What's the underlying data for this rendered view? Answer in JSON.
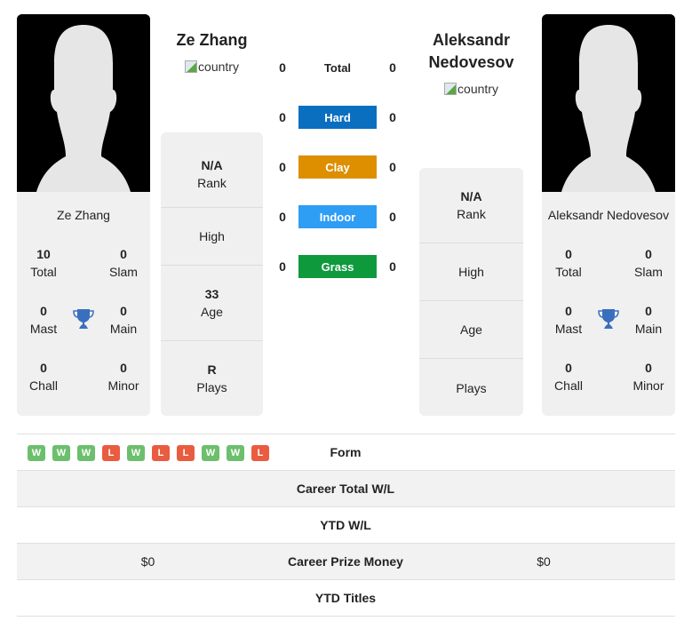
{
  "player1": {
    "name": "Ze Zhang",
    "country_alt": "country",
    "card_name": "Ze Zhang",
    "titles": {
      "total": {
        "value": "10",
        "label": "Total"
      },
      "slam": {
        "value": "0",
        "label": "Slam"
      },
      "mast": {
        "value": "0",
        "label": "Mast"
      },
      "main": {
        "value": "0",
        "label": "Main"
      },
      "chall": {
        "value": "0",
        "label": "Chall"
      },
      "minor": {
        "value": "0",
        "label": "Minor"
      }
    },
    "info": {
      "rank": {
        "value": "N/A",
        "label": "Rank"
      },
      "high": {
        "value": "",
        "label": "High"
      },
      "age": {
        "value": "33",
        "label": "Age"
      },
      "plays": {
        "value": "R",
        "label": "Plays"
      }
    }
  },
  "player2": {
    "name_line1": "Aleksandr",
    "name_line2": "Nedovesov",
    "country_alt": "country",
    "card_name": "Aleksandr Nedovesov",
    "titles": {
      "total": {
        "value": "0",
        "label": "Total"
      },
      "slam": {
        "value": "0",
        "label": "Slam"
      },
      "mast": {
        "value": "0",
        "label": "Mast"
      },
      "main": {
        "value": "0",
        "label": "Main"
      },
      "chall": {
        "value": "0",
        "label": "Chall"
      },
      "minor": {
        "value": "0",
        "label": "Minor"
      }
    },
    "info": {
      "rank": {
        "value": "N/A",
        "label": "Rank"
      },
      "high": {
        "value": "",
        "label": "High"
      },
      "age": {
        "value": "",
        "label": "Age"
      },
      "plays": {
        "value": "",
        "label": "Plays"
      }
    }
  },
  "h2h": {
    "total": {
      "label": "Total",
      "p1": "0",
      "p2": "0"
    },
    "surfaces": [
      {
        "label": "Hard",
        "p1": "0",
        "p2": "0",
        "color": "#0b6fc0"
      },
      {
        "label": "Clay",
        "p1": "0",
        "p2": "0",
        "color": "#dd8f00"
      },
      {
        "label": "Indoor",
        "p1": "0",
        "p2": "0",
        "color": "#2e9df4"
      },
      {
        "label": "Grass",
        "p1": "0",
        "p2": "0",
        "color": "#0e9a3c"
      }
    ]
  },
  "comparison": {
    "form_label": "Form",
    "form_p1": [
      "W",
      "W",
      "W",
      "L",
      "W",
      "L",
      "L",
      "W",
      "W",
      "L"
    ],
    "rows": [
      {
        "label": "Career Total W/L",
        "p1": "",
        "p2": ""
      },
      {
        "label": "YTD W/L",
        "p1": "",
        "p2": ""
      },
      {
        "label": "Career Prize Money",
        "p1": "$0",
        "p2": "$0"
      },
      {
        "label": "YTD Titles",
        "p1": "",
        "p2": ""
      }
    ]
  },
  "colors": {
    "trophy": "#3a6fbf",
    "win": "#6cbf6c",
    "loss": "#ea5c40"
  }
}
